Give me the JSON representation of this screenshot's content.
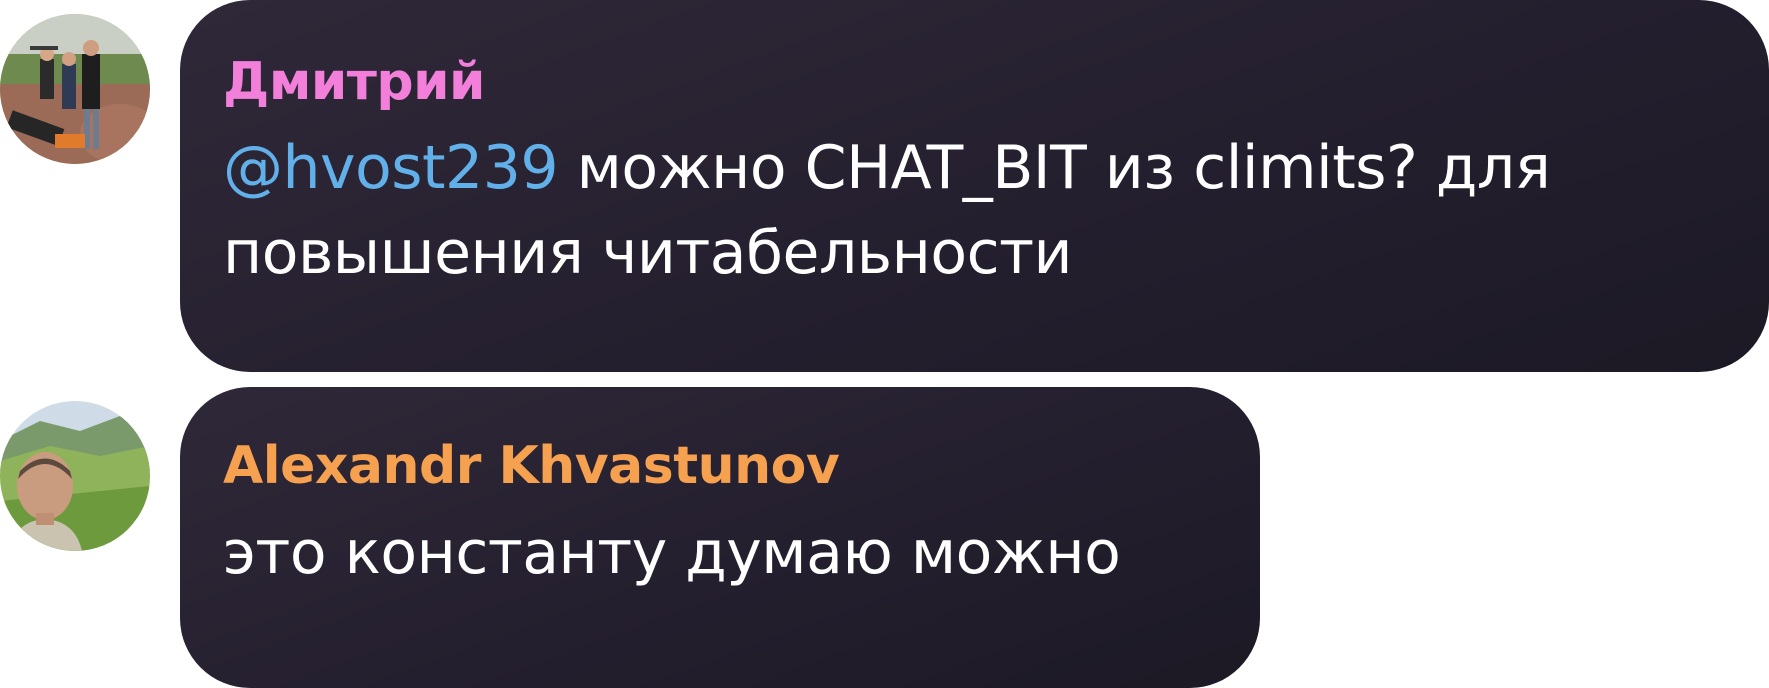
{
  "messages": [
    {
      "author": "Дмитрий",
      "author_color": "#f27fd9",
      "avatar": "group-photo-avatar",
      "mention": "@hvost239",
      "text_line1": " можно CHAT_BIT из climits? для",
      "text_line2": "повышения читабельности"
    },
    {
      "author": "Alexandr Khvastunov",
      "author_color": "#f6a14f",
      "avatar": "portrait-photo-avatar",
      "text": "это константу думаю можно"
    }
  ],
  "colors": {
    "bubble": "#241f2e",
    "mention": "#62b0ea",
    "text": "#ffffff"
  }
}
